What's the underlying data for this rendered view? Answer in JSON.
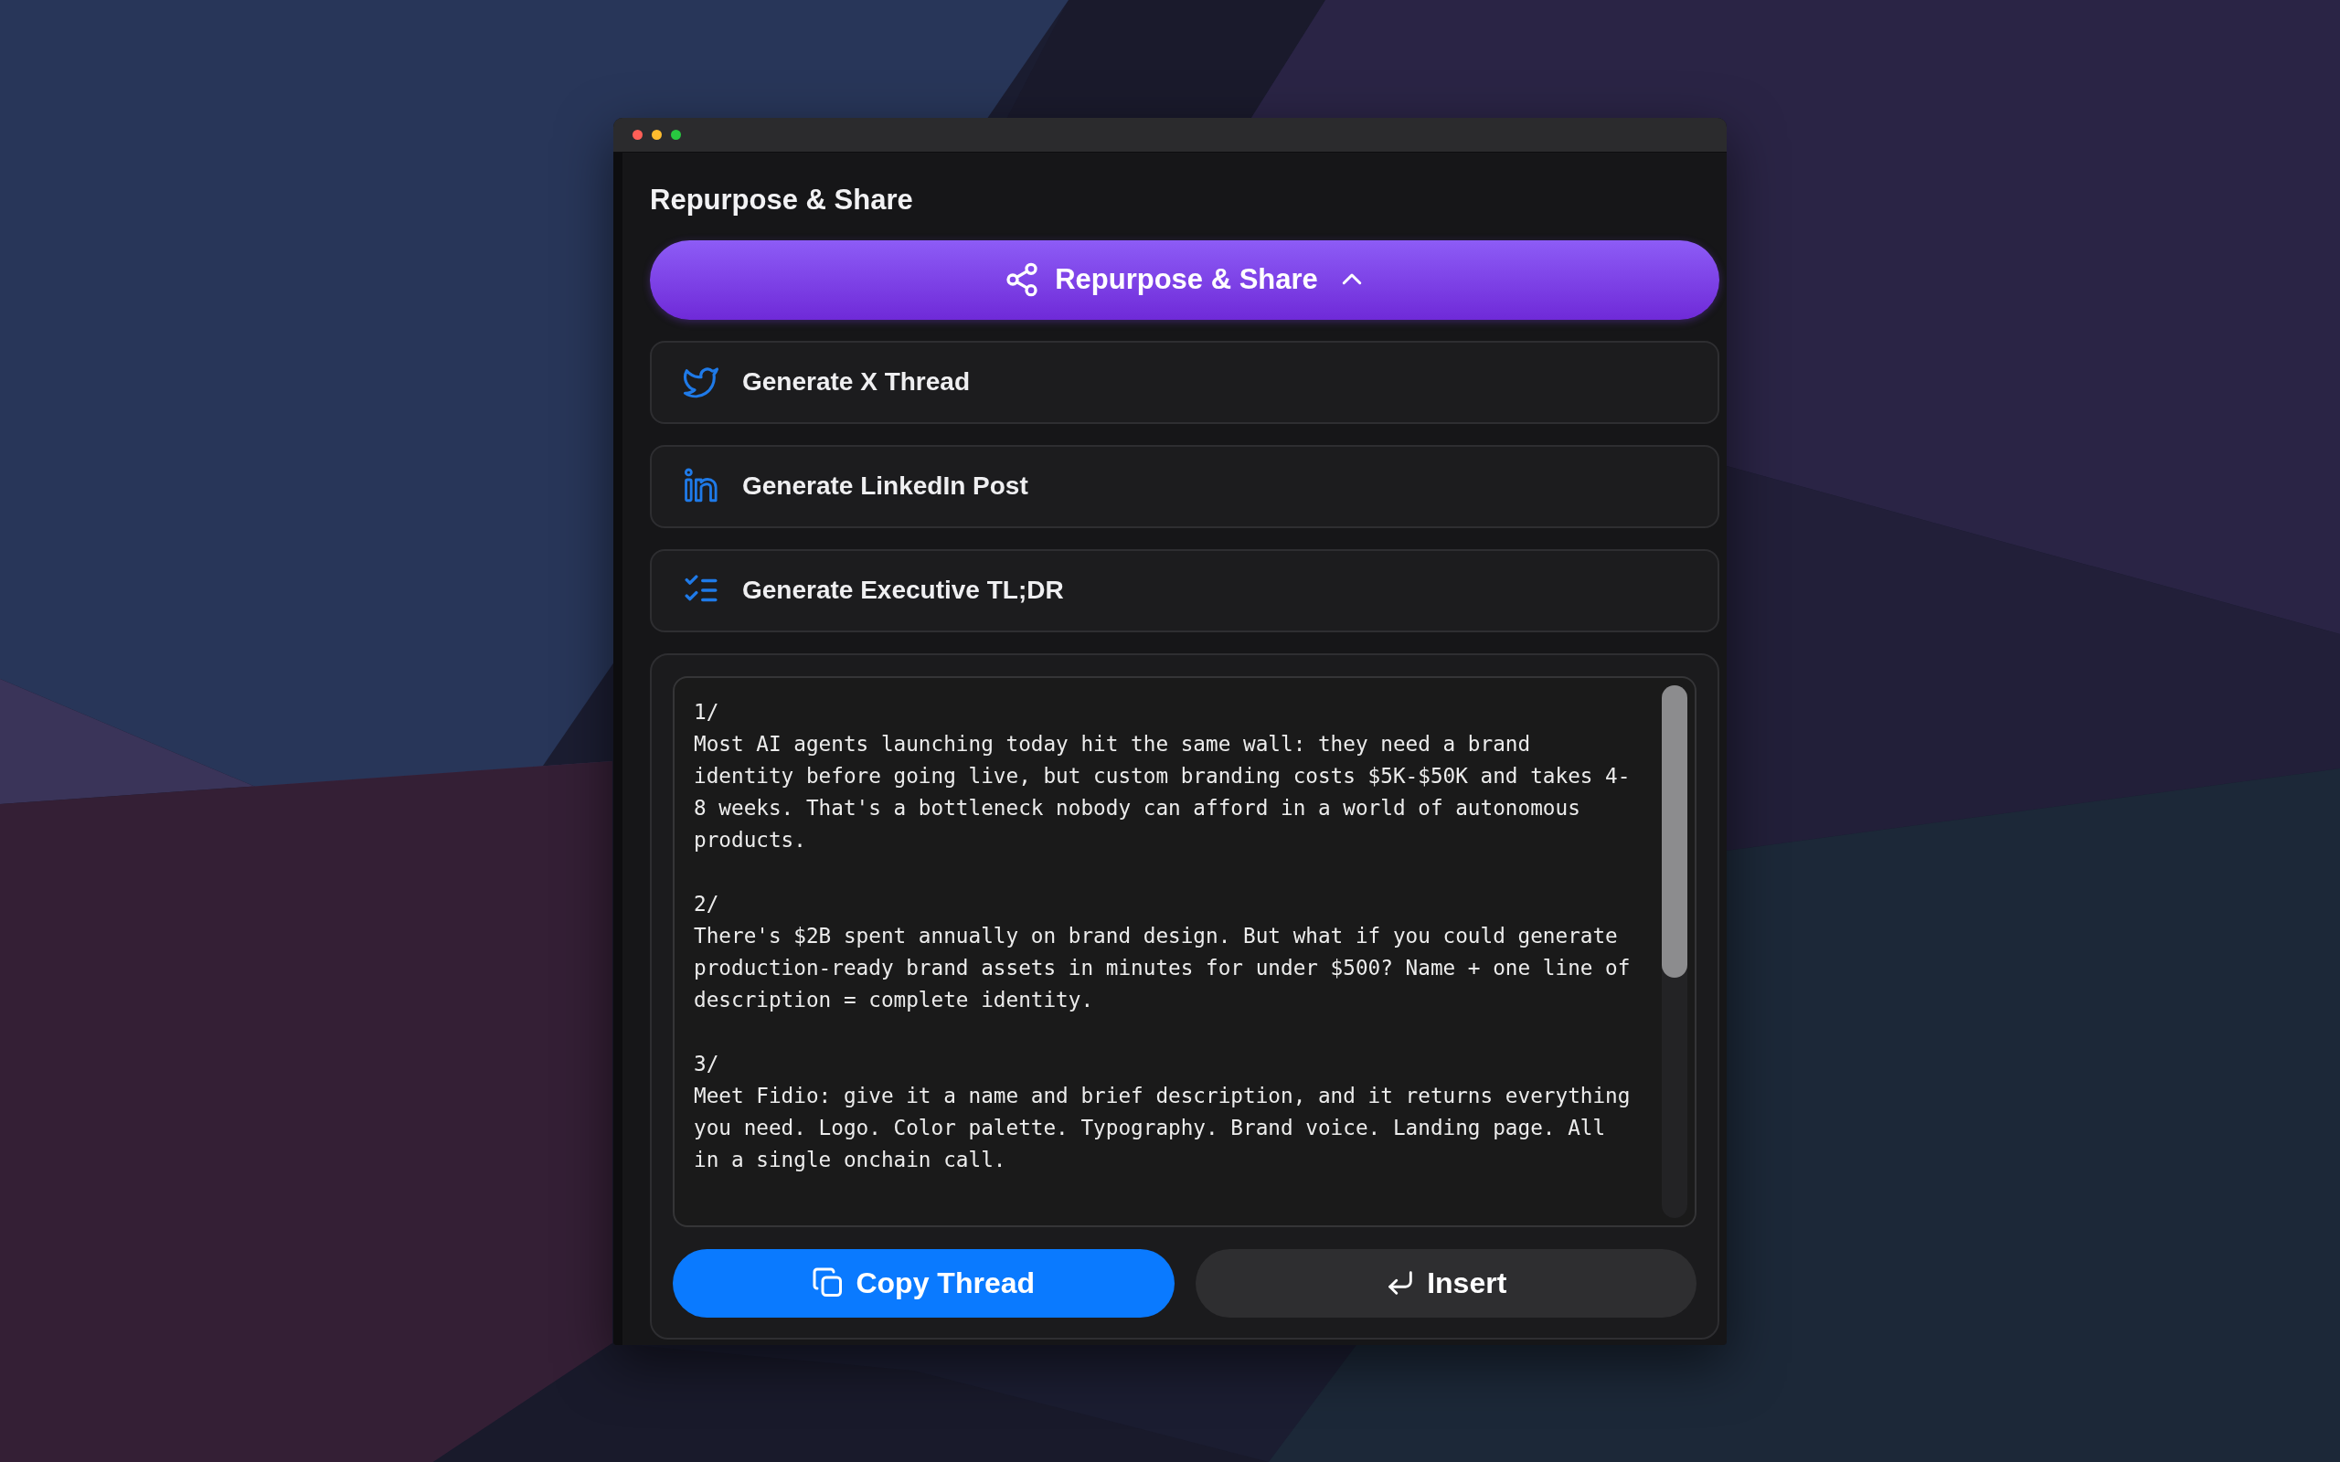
{
  "panel": {
    "heading": "Repurpose & Share",
    "toggle": {
      "label": "Repurpose & Share",
      "expanded": true
    }
  },
  "actions": [
    {
      "kind": "x-thread",
      "label": "Generate X Thread"
    },
    {
      "kind": "linkedin",
      "label": "Generate LinkedIn Post"
    },
    {
      "kind": "tldr",
      "label": "Generate Executive TL;DR"
    }
  ],
  "output": {
    "text": "1/\nMost AI agents launching today hit the same wall: they need a brand identity before going live, but custom branding costs $5K-$50K and takes 4-8 weeks. That's a bottleneck nobody can afford in a world of autonomous products.\n\n2/\nThere's $2B spent annually on brand design. But what if you could generate production-ready brand assets in minutes for under $500? Name + one line of description = complete identity.\n\n3/\nMeet Fidio: give it a name and brief description, and it returns everything you need. Logo. Color palette. Typography. Brand voice. Landing page. All in a single onchain call.",
    "buttons": [
      {
        "kind": "copy",
        "label": "Copy Thread"
      },
      {
        "kind": "insert",
        "label": "Insert"
      }
    ]
  }
}
